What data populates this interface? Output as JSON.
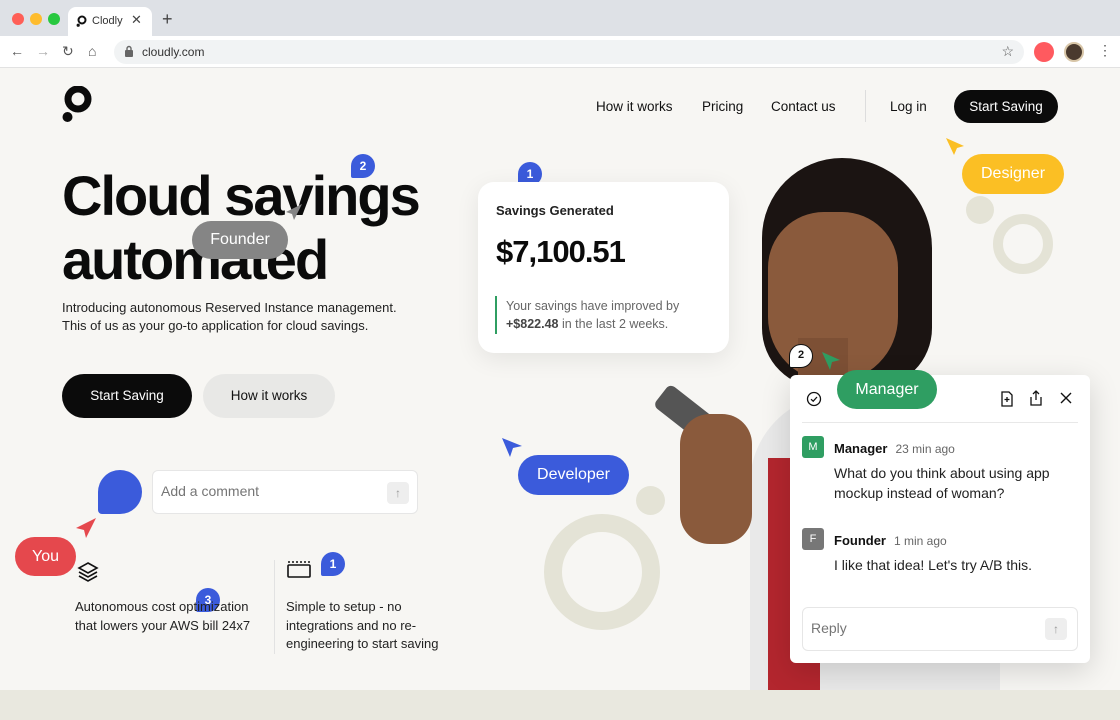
{
  "browser": {
    "tab_title": "Clodly",
    "url": "cloudly.com",
    "traffic_colors": [
      "#ff5f57",
      "#febc2e",
      "#28c840"
    ]
  },
  "nav": {
    "links": [
      "How it works",
      "Pricing",
      "Contact us"
    ],
    "login": "Log in",
    "cta": "Start Saving"
  },
  "hero": {
    "title_line1": "Cloud savings",
    "title_line2": "automated",
    "subtitle_line1": "Introducing autonomous Reserved Instance management.",
    "subtitle_line2": "This of us as your go-to application for cloud savings.",
    "primary_button": "Start Saving",
    "secondary_button": "How it works"
  },
  "savings_card": {
    "label": "Savings Generated",
    "amount": "$7,100.51",
    "note_prefix": "Your savings have improved by",
    "note_amount": "+$822.48",
    "note_suffix": "in the last 2 weeks."
  },
  "comment_input": {
    "placeholder": "Add a comment"
  },
  "features": [
    {
      "text": "Autonomous cost optimization that lowers your AWS bill 24x7",
      "icon": "layers-icon"
    },
    {
      "text": "Simple to setup - no integrations and no re-engineering to start saving",
      "icon": "window-icon"
    }
  ],
  "cursors": {
    "founder": {
      "label": "Founder",
      "color": "#858585"
    },
    "designer": {
      "label": "Designer",
      "color": "#fbbf24"
    },
    "developer": {
      "label": "Developer",
      "color": "#3b5bdb"
    },
    "manager": {
      "label": "Manager",
      "color": "#2f9e62"
    },
    "you": {
      "label": "You",
      "color": "#e5484d"
    }
  },
  "badges": {
    "title": "2",
    "card": "1",
    "feature1": "3",
    "feature2": "1",
    "panel": "2"
  },
  "chat": {
    "messages": [
      {
        "initial": "M",
        "name": "Manager",
        "time": "23 min ago",
        "text": "What do you think about using app mockup instead of woman?",
        "color": "#2f9e62"
      },
      {
        "initial": "F",
        "name": "Founder",
        "time": "1 min ago",
        "text": "I like that idea! Let's try A/B this.",
        "color": "#777777"
      }
    ],
    "reply_placeholder": "Reply"
  }
}
